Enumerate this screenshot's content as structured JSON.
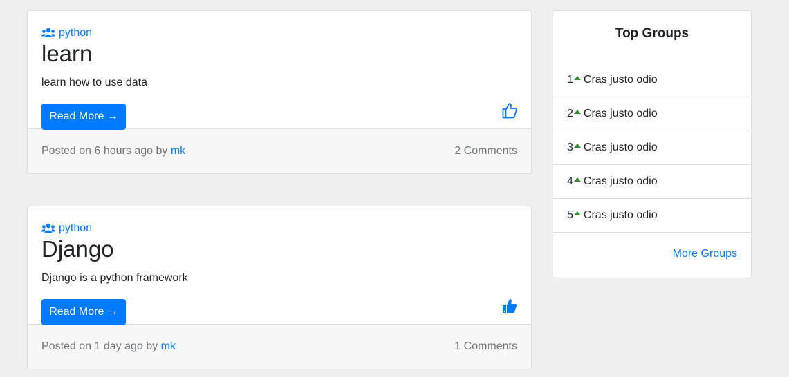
{
  "posts": [
    {
      "group": "python",
      "title": "learn",
      "description": "learn how to use data",
      "read_more": "Read More →",
      "posted_prefix": "Posted on 6 hours ago by",
      "author": "mk",
      "comments": "2 Comments",
      "liked": false
    },
    {
      "group": "python",
      "title": "Django",
      "description": "Django is a python framework",
      "read_more": "Read More →",
      "posted_prefix": "Posted on 1 day ago by",
      "author": "mk",
      "comments": "1 Comments",
      "liked": true
    }
  ],
  "sidebar": {
    "title": "Top Groups",
    "groups": [
      {
        "rank": "1",
        "name": "Cras justo odio"
      },
      {
        "rank": "2",
        "name": "Cras justo odio"
      },
      {
        "rank": "3",
        "name": "Cras justo odio"
      },
      {
        "rank": "4",
        "name": "Cras justo odio"
      },
      {
        "rank": "5",
        "name": "Cras justo odio"
      }
    ],
    "more_link": "More Groups"
  },
  "colors": {
    "accent": "#007bff",
    "trend_up": "#2e8b2e",
    "background": "#efefef"
  }
}
